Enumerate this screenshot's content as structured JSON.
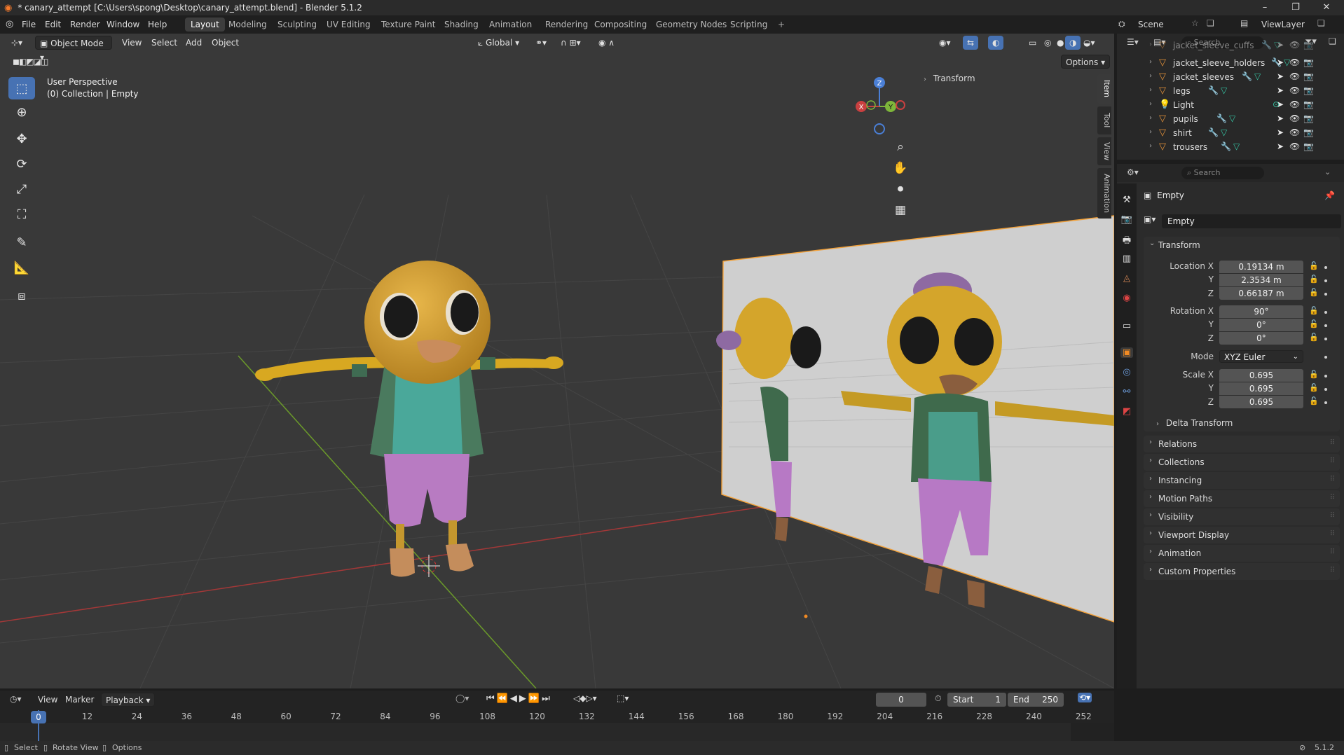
{
  "window": {
    "title": "* canary_attempt [C:\\Users\\spong\\Desktop\\canary_attempt.blend] - Blender 5.1.2",
    "controls": [
      "–",
      "❐",
      "✕"
    ]
  },
  "menus": [
    "File",
    "Edit",
    "Render",
    "Window",
    "Help"
  ],
  "workspaces": [
    "Layout",
    "Modeling",
    "Sculpting",
    "UV Editing",
    "Texture Paint",
    "Shading",
    "Animation",
    "Rendering",
    "Compositing",
    "Geometry Nodes",
    "Scripting"
  ],
  "active_workspace": "Layout",
  "add_workspace": "+",
  "scene": {
    "label": "Scene",
    "view_layer": "ViewLayer"
  },
  "viewport_header": {
    "mode": "Object Mode",
    "menus": [
      "View",
      "Select",
      "Add",
      "Object"
    ],
    "orientation": "Global",
    "options": "Options"
  },
  "viewport": {
    "perspective": "User Perspective",
    "collection": "(0) Collection | Empty",
    "n_panel_title": "Transform",
    "side_tabs": [
      "Item",
      "Tool",
      "View",
      "Animation"
    ],
    "gizmo_labels": {
      "x": "X",
      "y": "Y",
      "z": "Z"
    }
  },
  "outliner": {
    "search_placeholder": "Search",
    "items": [
      {
        "name": "jacket_sleeve_cuffs",
        "type": "mesh"
      },
      {
        "name": "jacket_sleeve_holders",
        "type": "mesh"
      },
      {
        "name": "jacket_sleeves",
        "type": "mesh"
      },
      {
        "name": "legs",
        "type": "mesh"
      },
      {
        "name": "Light",
        "type": "light"
      },
      {
        "name": "pupils",
        "type": "mesh"
      },
      {
        "name": "shirt",
        "type": "mesh"
      },
      {
        "name": "trousers",
        "type": "mesh"
      }
    ]
  },
  "properties": {
    "search_placeholder": "Search",
    "object_name": "Empty",
    "datablock_name": "Empty",
    "transform": {
      "title": "Transform",
      "location_label": "Location X",
      "location": [
        "0.19134 m",
        "2.3534 m",
        "0.66187 m"
      ],
      "rotation_label": "Rotation X",
      "rotation": [
        "90°",
        "0°",
        "0°"
      ],
      "mode_label": "Mode",
      "mode": "XYZ Euler",
      "scale_label": "Scale X",
      "scale": [
        "0.695",
        "0.695",
        "0.695"
      ],
      "y_label": "Y",
      "z_label": "Z",
      "delta": "Delta Transform"
    },
    "panels": [
      "Relations",
      "Collections",
      "Instancing",
      "Motion Paths",
      "Visibility",
      "Viewport Display",
      "Animation",
      "Custom Properties"
    ]
  },
  "timeline": {
    "menus": [
      "View",
      "Marker",
      "Playback"
    ],
    "current_frame": "0",
    "start_label": "Start",
    "start": "1",
    "end_label": "End",
    "end": "250",
    "ticks": [
      "0",
      "12",
      "24",
      "36",
      "48",
      "60",
      "72",
      "84",
      "96",
      "108",
      "120",
      "132",
      "144",
      "156",
      "168",
      "180",
      "192",
      "204",
      "216",
      "228",
      "240",
      "252"
    ]
  },
  "statusbar": {
    "items": [
      "Select",
      "Rotate View",
      "Options"
    ],
    "version": "5.1.2"
  },
  "colors": {
    "accent": "#4772b3",
    "viewport_bg": "#393939",
    "panel_bg": "#2b2b2b",
    "mesh_icon": "#e9953a",
    "modifier_icon": "#6b9ad8",
    "data_icon": "#36c7a6"
  }
}
